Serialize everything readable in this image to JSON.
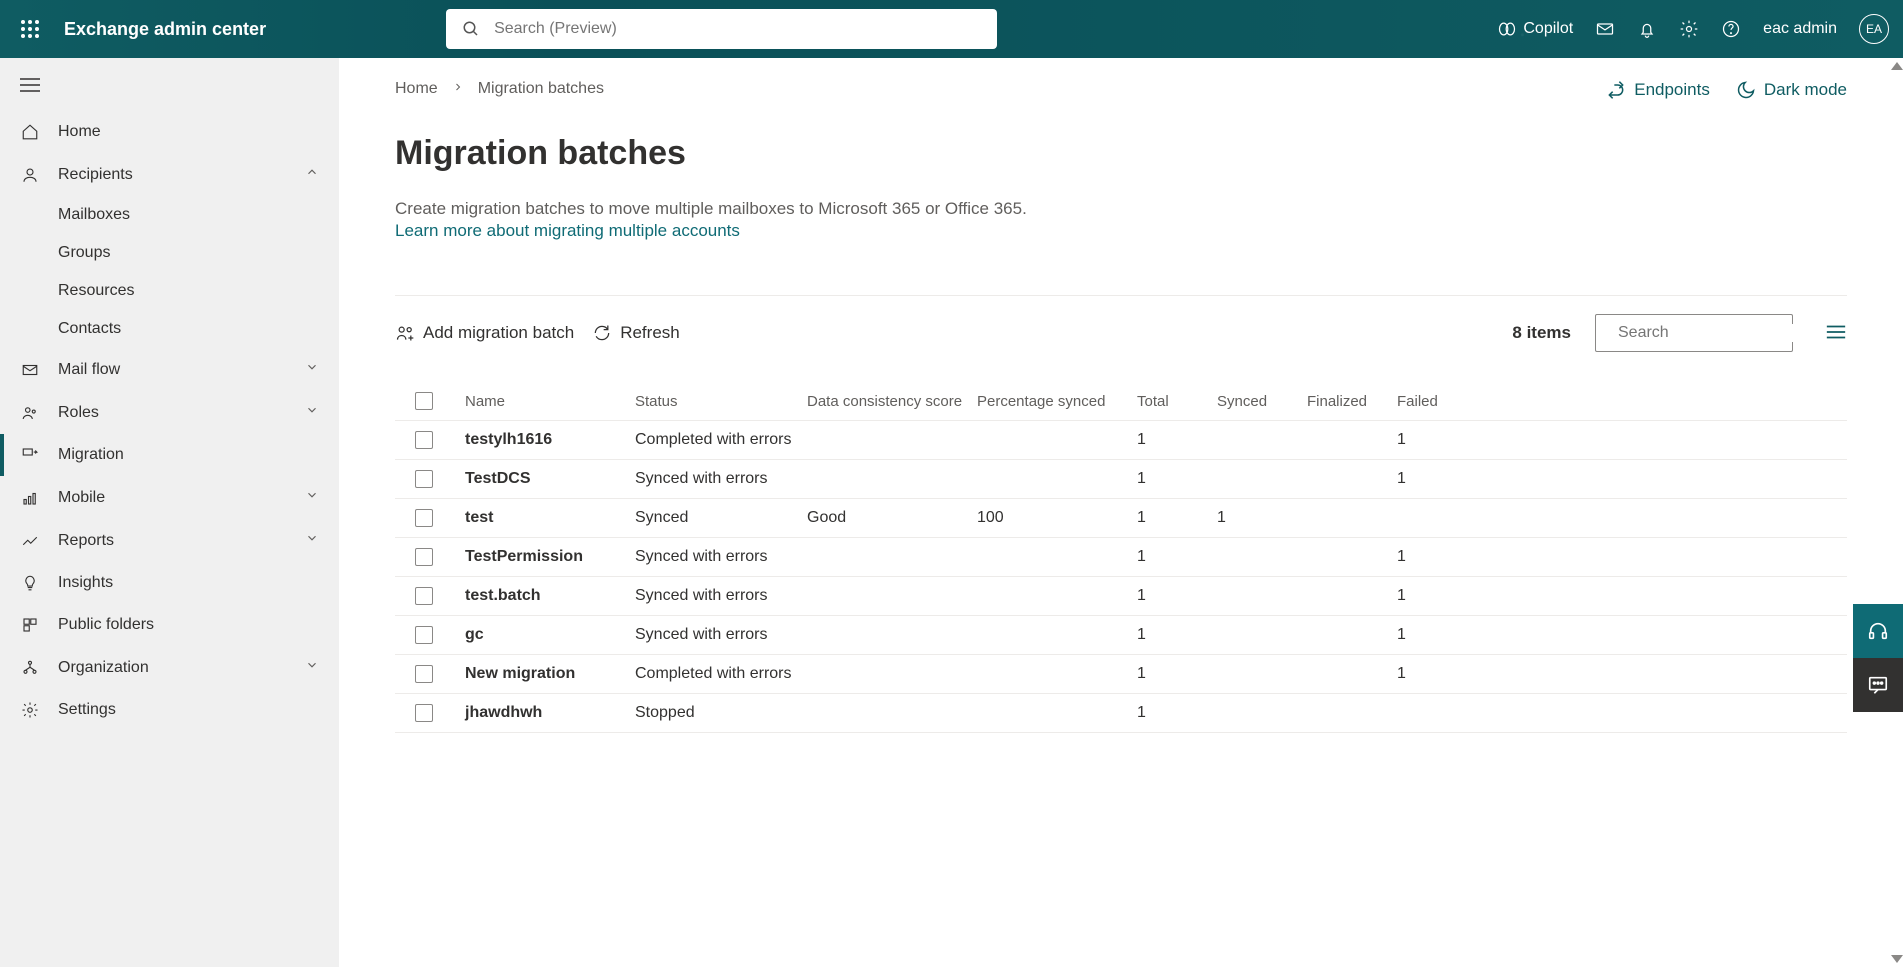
{
  "header": {
    "app_title": "Exchange admin center",
    "search_placeholder": "Search (Preview)",
    "copilot": "Copilot",
    "user_name": "eac admin",
    "user_initials": "EA"
  },
  "sidebar": {
    "items": [
      {
        "label": "Home"
      },
      {
        "label": "Recipients",
        "expanded": true
      },
      {
        "label": "Mail flow"
      },
      {
        "label": "Roles"
      },
      {
        "label": "Migration",
        "active": true
      },
      {
        "label": "Mobile"
      },
      {
        "label": "Reports"
      },
      {
        "label": "Insights"
      },
      {
        "label": "Public folders"
      },
      {
        "label": "Organization"
      },
      {
        "label": "Settings"
      }
    ],
    "recipients_sub": [
      {
        "label": "Mailboxes"
      },
      {
        "label": "Groups"
      },
      {
        "label": "Resources"
      },
      {
        "label": "Contacts"
      }
    ]
  },
  "breadcrumbs": {
    "home": "Home",
    "current": "Migration batches"
  },
  "actions": {
    "endpoints": "Endpoints",
    "dark_mode": "Dark mode"
  },
  "page": {
    "title": "Migration batches",
    "description": "Create migration batches to move multiple mailboxes to Microsoft 365 or Office 365.",
    "learn_link": "Learn more about migrating multiple accounts"
  },
  "toolbar": {
    "add_label": "Add migration batch",
    "refresh_label": "Refresh",
    "item_count": "8 items",
    "search_placeholder": "Search"
  },
  "table": {
    "columns": {
      "name": "Name",
      "status": "Status",
      "dcs": "Data consistency score",
      "pct": "Percentage synced",
      "total": "Total",
      "synced": "Synced",
      "finalized": "Finalized",
      "failed": "Failed"
    },
    "rows": [
      {
        "name": "testylh1616",
        "status": "Completed with errors",
        "dcs": "",
        "pct": "",
        "total": "1",
        "synced": "",
        "finalized": "",
        "failed": "1"
      },
      {
        "name": "TestDCS",
        "status": "Synced with errors",
        "dcs": "",
        "pct": "",
        "total": "1",
        "synced": "",
        "finalized": "",
        "failed": "1"
      },
      {
        "name": "test",
        "status": "Synced",
        "dcs": "Good",
        "pct": "100",
        "total": "1",
        "synced": "1",
        "finalized": "",
        "failed": ""
      },
      {
        "name": "TestPermission",
        "status": "Synced with errors",
        "dcs": "",
        "pct": "",
        "total": "1",
        "synced": "",
        "finalized": "",
        "failed": "1"
      },
      {
        "name": "test.batch",
        "status": "Synced with errors",
        "dcs": "",
        "pct": "",
        "total": "1",
        "synced": "",
        "finalized": "",
        "failed": "1"
      },
      {
        "name": "gc",
        "status": "Synced with errors",
        "dcs": "",
        "pct": "",
        "total": "1",
        "synced": "",
        "finalized": "",
        "failed": "1"
      },
      {
        "name": "New migration",
        "status": "Completed with errors",
        "dcs": "",
        "pct": "",
        "total": "1",
        "synced": "",
        "finalized": "",
        "failed": "1"
      },
      {
        "name": "jhawdhwh",
        "status": "Stopped",
        "dcs": "",
        "pct": "",
        "total": "1",
        "synced": "",
        "finalized": "",
        "failed": ""
      }
    ]
  }
}
